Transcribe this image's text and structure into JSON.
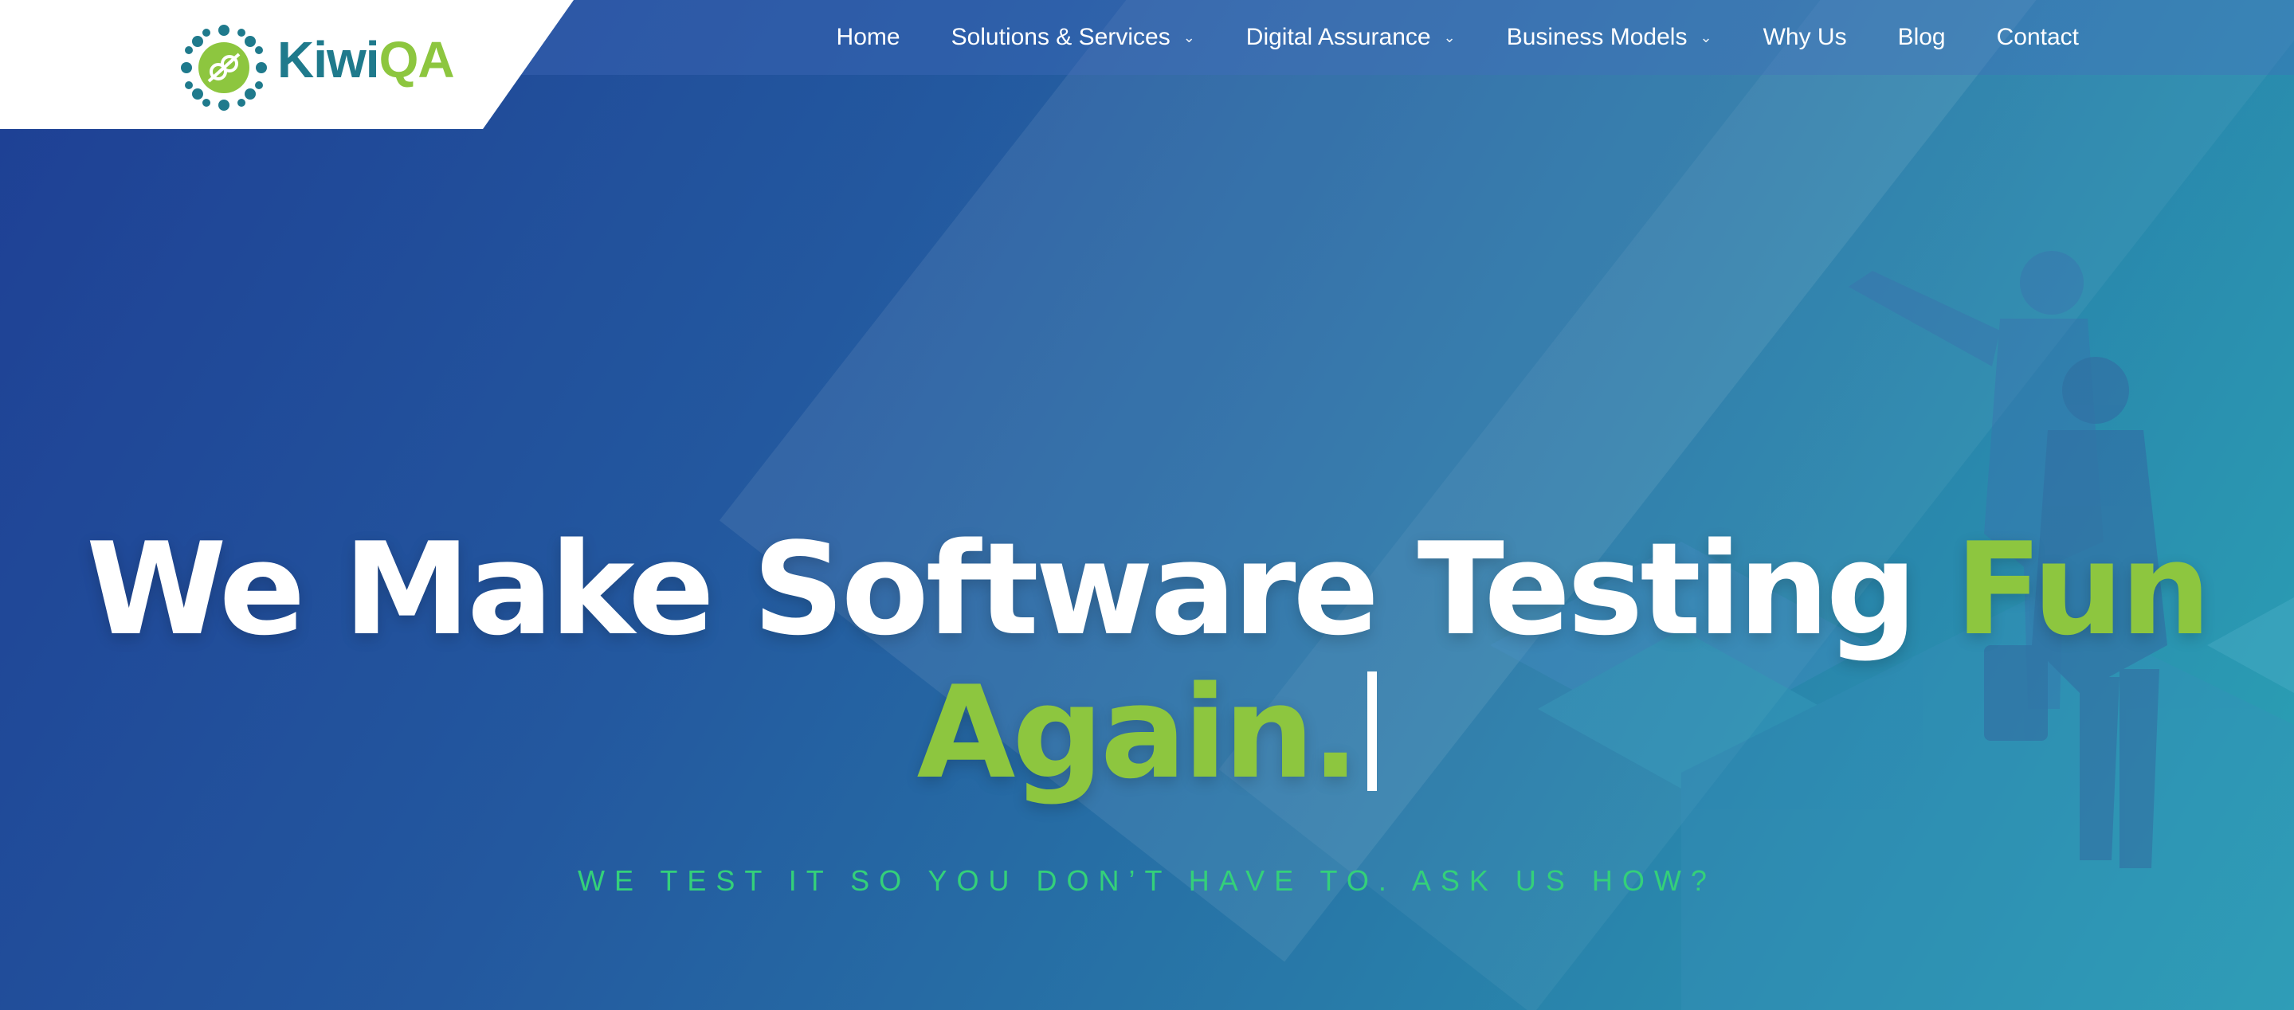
{
  "brand": {
    "name_part1": "Kiwi",
    "name_part2": "QA"
  },
  "nav": {
    "items": [
      {
        "label": "Home",
        "dropdown": false
      },
      {
        "label": "Solutions & Services",
        "dropdown": true
      },
      {
        "label": "Digital Assurance",
        "dropdown": true
      },
      {
        "label": "Business Models",
        "dropdown": true
      },
      {
        "label": "Why Us",
        "dropdown": false
      },
      {
        "label": "Blog",
        "dropdown": false
      },
      {
        "label": "Contact",
        "dropdown": false
      }
    ],
    "dropdown_icon": "chevron-down-icon"
  },
  "hero": {
    "headline_white": "We Make Software Testing",
    "headline_green_1": "Fun",
    "headline_green_2": "Again.",
    "tagline": "WE TEST IT SO YOU DON’T HAVE TO. ASK US HOW?"
  },
  "colors": {
    "accent_green": "#8dc63f",
    "tagline_green": "#34d07a",
    "brand_teal": "#1f7a8c",
    "hero_blue": "#1e3f94",
    "hero_teal": "#2ba3b5"
  }
}
